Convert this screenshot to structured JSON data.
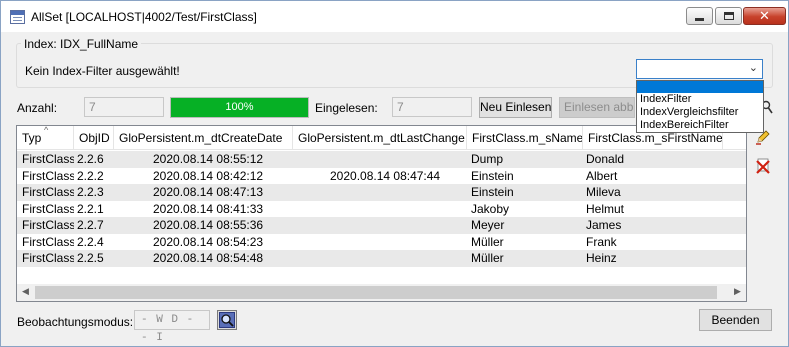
{
  "window": {
    "title": "AllSet [LOCALHOST|4002/Test/FirstClass]"
  },
  "index_group": {
    "legend": "Index: IDX_FullName",
    "filter_text": "Kein Index-Filter ausgewählt!",
    "combo_value": "",
    "dropdown_options": [
      "IndexFilter",
      "IndexVergleichsfilter",
      "IndexBereichFilter"
    ]
  },
  "toolbar": {
    "anzahl_label": "Anzahl:",
    "anzahl_value": "7",
    "progress_text": "100%",
    "progress_fraction": 1.0,
    "eingelesen_label": "Eingelesen:",
    "eingelesen_value": "7",
    "neu_einlesen_label": "Neu Einlesen",
    "einlesen_abbrechen_label": "Einlesen abbrechen"
  },
  "table": {
    "columns": [
      "Typ",
      "ObjID",
      "GloPersistent.m_dtCreateDate",
      "GloPersistent.m_dtLastChange",
      "FirstClass.m_sName",
      "FirstClass.m_sFirstName"
    ],
    "rows": [
      [
        "FirstClass",
        "2.2.6",
        "2020.08.14 08:55:12",
        "",
        "Dump",
        "Donald"
      ],
      [
        "FirstClass",
        "2.2.2",
        "2020.08.14 08:42:12",
        "2020.08.14 08:47:44",
        "Einstein",
        "Albert"
      ],
      [
        "FirstClass",
        "2.2.3",
        "2020.08.14 08:47:13",
        "",
        "Einstein",
        "Mileva"
      ],
      [
        "FirstClass",
        "2.2.1",
        "2020.08.14 08:41:33",
        "",
        "Jakoby",
        "Helmut"
      ],
      [
        "FirstClass",
        "2.2.7",
        "2020.08.14 08:55:36",
        "",
        "Meyer",
        "James"
      ],
      [
        "FirstClass",
        "2.2.4",
        "2020.08.14 08:54:23",
        "",
        "Müller",
        "Frank"
      ],
      [
        "FirstClass",
        "2.2.5",
        "2020.08.14 08:54:48",
        "",
        "Müller",
        "Heinz"
      ]
    ]
  },
  "footer": {
    "mode_label": "Beobachtungsmodus:",
    "mode_value": "- W D - - I",
    "beenden_label": "Beenden"
  },
  "colors": {
    "progress": "#06b025",
    "selection": "#0078d7",
    "close_button": "#c7412b"
  },
  "icons": [
    "app-window-icon",
    "minimize-icon",
    "maximize-icon",
    "close-icon",
    "chevron-down-icon",
    "search-icon",
    "edit-icon",
    "delete-icon",
    "magnifier-icon"
  ]
}
